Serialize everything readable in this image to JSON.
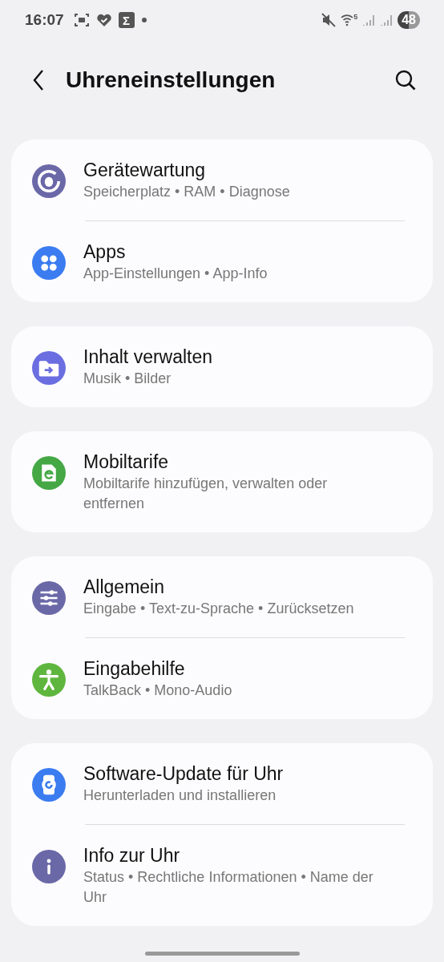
{
  "status_bar": {
    "time": "16:07",
    "sigma": "Σ",
    "wifi_badge": "5",
    "battery": "48"
  },
  "header": {
    "title": "Uhreneinstellungen"
  },
  "groups": [
    {
      "items": [
        {
          "title": "Gerätewartung",
          "subtitle": "Speicherplatz • RAM • Diagnose",
          "color": "#6b68a8"
        },
        {
          "title": "Apps",
          "subtitle": "App-Einstellungen • App-Info",
          "color": "#3b7cf0"
        }
      ]
    },
    {
      "items": [
        {
          "title": "Inhalt verwalten",
          "subtitle": "Musik • Bilder",
          "color": "#6a6ee0"
        }
      ]
    },
    {
      "items": [
        {
          "title": "Mobiltarife",
          "subtitle": "Mobiltarife hinzufügen, verwalten oder entfernen",
          "color": "#45a845"
        }
      ]
    },
    {
      "items": [
        {
          "title": "Allgemein",
          "subtitle": "Eingabe • Text-zu-Sprache • Zurücksetzen",
          "color": "#6b68a8"
        },
        {
          "title": "Eingabehilfe",
          "subtitle": "TalkBack • Mono-Audio",
          "color": "#5fb63e"
        }
      ]
    },
    {
      "items": [
        {
          "title": "Software-Update für Uhr",
          "subtitle": "Herunterladen und installieren",
          "color": "#3b7cf0"
        },
        {
          "title": "Info zur Uhr",
          "subtitle": "Status • Rechtliche Informationen • Name der Uhr",
          "color": "#6b68a8"
        }
      ]
    }
  ]
}
